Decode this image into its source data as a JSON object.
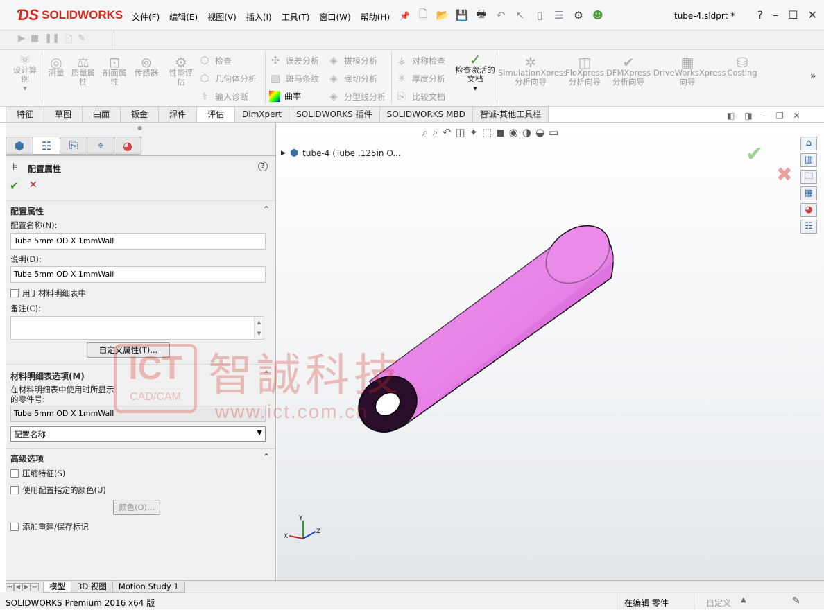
{
  "app": {
    "brand": "SOLIDWORKS",
    "filename": "tube-4.sldprt *"
  },
  "menu": [
    "文件(F)",
    "编辑(E)",
    "视图(V)",
    "插入(I)",
    "工具(T)",
    "窗口(W)",
    "帮助(H)"
  ],
  "ribbon": {
    "design_study": "设计算例",
    "measure": "测量",
    "mass_props": "质量属性",
    "section_props": "剖面属性",
    "sensor": "传感器",
    "perf_eval": "性能评估",
    "check": "检查",
    "geom_analysis": "几何体分析",
    "import_diag": "输入诊断",
    "deviation": "误差分析",
    "zebra": "斑马条纹",
    "curvature": "曲率",
    "draft": "拔模分析",
    "undercut": "底切分析",
    "parting_line": "分型线分析",
    "symmetry": "对称检查",
    "thickness": "厚度分析",
    "compare": "比较文档",
    "check_active": "检查激活的文档",
    "sim_x": "SimulationXpress 分析向导",
    "flo_x": "FloXpress 分析向导",
    "dfm_x": "DFMXpress 分析向导",
    "dw_x": "DriveWorksXpress 向导",
    "costing": "Costing"
  },
  "tabs": [
    "特征",
    "草图",
    "曲面",
    "钣金",
    "焊件",
    "评估",
    "DimXpert",
    "SOLIDWORKS 插件",
    "SOLIDWORKS MBD",
    "智诚-其他工具栏"
  ],
  "active_tab": "评估",
  "panel": {
    "title": "配置属性",
    "section1": "配置属性",
    "config_name_label": "配置名称(N):",
    "config_name_value": "Tube 5mm OD X 1mmWall",
    "desc_label": "说明(D):",
    "desc_value": "Tube 5mm OD X 1mmWall",
    "use_in_bom": "用于材料明细表中",
    "notes_label": "备注(C):",
    "custom_props_btn": "自定义属性(T)...",
    "bom_section": "材料明细表选项(M)",
    "bom_desc": "在材料明细表中使用时所显示的零件号:",
    "bom_value": "Tube 5mm OD X 1mmWall",
    "bom_select": "配置名称",
    "adv_section": "高级选项",
    "suppress": "压缩特征(S)",
    "use_color": "使用配置指定的颜色(U)",
    "color_btn": "颜色(O)...",
    "add_rebuild": "添加重建/保存标记"
  },
  "tree": {
    "item": "tube-4  (Tube .125in O..."
  },
  "bottom_tabs": [
    "模型",
    "3D 视图",
    "Motion Study 1"
  ],
  "status": {
    "left": "SOLIDWORKS Premium 2016 x64 版",
    "editing": "在编辑 零件",
    "custom": "自定义"
  },
  "watermark": {
    "logo": "ICT",
    "sub": "CAD/CAM",
    "cn": "智誠科技",
    "url": "www.ict.com.cn"
  },
  "colors": {
    "accent": "#d52b1e",
    "tube": "#e985e9",
    "ok": "#3b8f2e",
    "cancel": "#c02020"
  }
}
